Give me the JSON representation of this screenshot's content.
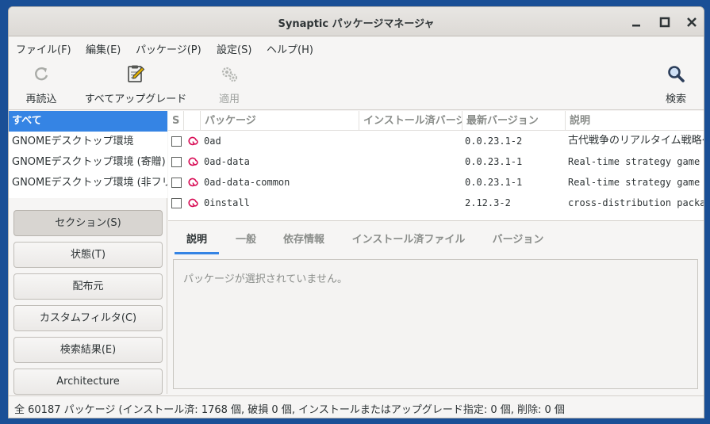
{
  "window": {
    "title": "Synaptic パッケージマネージャ"
  },
  "menu": [
    "ファイル(F)",
    "編集(E)",
    "パッケージ(P)",
    "設定(S)",
    "ヘルプ(H)"
  ],
  "toolbar": {
    "reload": "再読込",
    "mark_all_upgrades": "すべてアップグレード",
    "apply": "適用",
    "search": "検索"
  },
  "filters": {
    "items": [
      "すべて",
      "GNOMEデスクトップ環境",
      "GNOMEデスクトップ環境 (寄贈)",
      "GNOMEデスクトップ環境 (非フリー)"
    ],
    "selected": 0
  },
  "side_buttons": [
    "セクション(S)",
    "状態(T)",
    "配布元",
    "カスタムフィルタ(C)",
    "検索結果(E)",
    "Architecture"
  ],
  "table": {
    "headers": [
      "S",
      "",
      "パッケージ",
      "インストール済バージョン",
      "最新バージョン",
      "説明"
    ],
    "rows": [
      {
        "name": "0ad",
        "installed": "",
        "latest": "0.0.23.1-2",
        "desc": "古代戦争のリアルタイム戦略ゲーム"
      },
      {
        "name": "0ad-data",
        "installed": "",
        "latest": "0.0.23.1-1",
        "desc": "Real-time strategy game of ancient warfare (data files)"
      },
      {
        "name": "0ad-data-common",
        "installed": "",
        "latest": "0.0.23.1-1",
        "desc": "Real-time strategy game of ancient warfare (common data files)"
      },
      {
        "name": "0install",
        "installed": "",
        "latest": "2.12.3-2",
        "desc": "cross-distribution packaging system"
      }
    ]
  },
  "detail": {
    "tabs": [
      "説明",
      "一般",
      "依存情報",
      "インストール済ファイル",
      "バージョン"
    ],
    "active_tab": 0,
    "message": "パッケージが選択されていません。"
  },
  "status": "全 60187 パッケージ (インストール済: 1768 個, 破損 0 個, インストールまたはアップグレード指定: 0 個, 削除: 0 個",
  "colors": {
    "accent": "#3584e4",
    "desktop": "#1a4f96",
    "debian_red": "#d70a53"
  }
}
